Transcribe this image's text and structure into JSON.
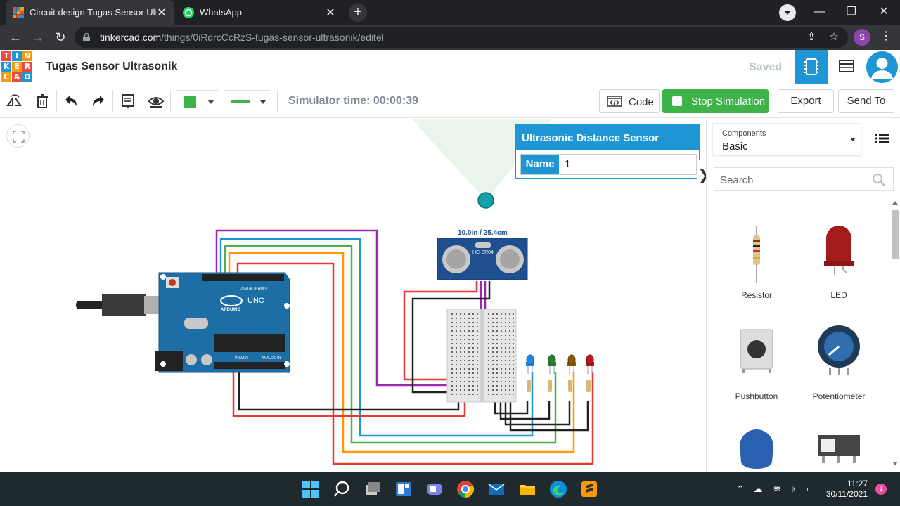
{
  "browser": {
    "tabs": [
      {
        "title": "Circuit design Tugas Sensor Ultra",
        "active": true
      },
      {
        "title": "WhatsApp",
        "active": false
      }
    ],
    "url_host": "tinkercad.com",
    "url_path": "/things/0iRdrcCcRzS-tugas-sensor-ultrasonik/editel",
    "profile_initial": "S"
  },
  "app": {
    "logo_letters": [
      "T",
      "I",
      "N",
      "K",
      "E",
      "R",
      "C",
      "A",
      "D"
    ],
    "logo_colors": [
      "#e74c3c",
      "#1e96d6",
      "#f39c12",
      "#1e96d6",
      "#f39c12",
      "#e74c3c",
      "#f39c12",
      "#e74c3c",
      "#1e96d6"
    ],
    "title": "Tugas Sensor Ultrasonik",
    "saved_label": "Saved"
  },
  "toolbar": {
    "sim_time": "Simulator time: 00:00:39",
    "code_label": "Code",
    "stop_label": "Stop Simulation",
    "export_label": "Export",
    "sendto_label": "Send To",
    "wire_color": "#3db34a"
  },
  "inspector": {
    "title": "Ultrasonic Distance Sensor",
    "name_key": "Name",
    "name_value": "1"
  },
  "canvas": {
    "distance_label": "10.0in / 25.4cm",
    "sensor_model": "HC-SR04",
    "board_brand": "ARDUINO",
    "board_model": "UNO",
    "digital_label": "DIGITAL (PWM~)",
    "power_label": "POWER",
    "analog_label": "ANALOG IN",
    "led_colors": [
      "#1e88e5",
      "#2e7d32",
      "#8d5a00",
      "#b71c1c"
    ]
  },
  "components": {
    "category_caption": "Components",
    "category_value": "Basic",
    "search_placeholder": "Search",
    "items": [
      "Resistor",
      "LED",
      "Pushbutton",
      "Potentiometer"
    ]
  },
  "taskbar": {
    "time": "11:27",
    "date": "30/11/2021",
    "notifications": "1"
  }
}
